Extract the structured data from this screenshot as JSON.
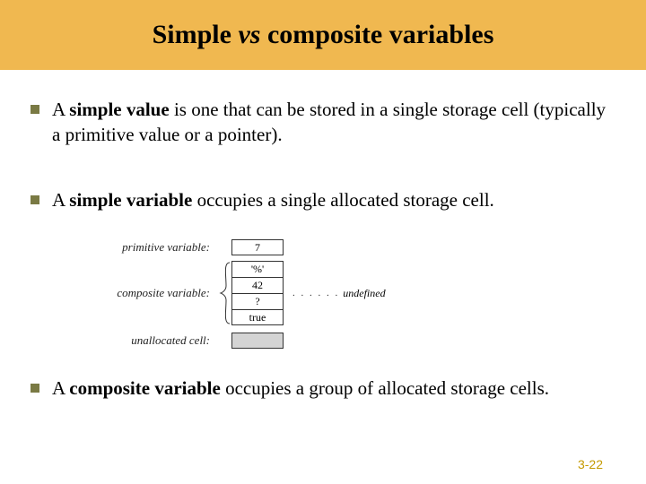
{
  "header": {
    "title_pre": "Simple ",
    "title_vs": "vs",
    "title_post": " composite variables"
  },
  "bullets": {
    "b1_pre": "A ",
    "b1_bold": "simple value",
    "b1_post": " is one that can be stored in a single storage cell (typically a primitive value or a pointer).",
    "b2_pre": "A ",
    "b2_bold": "simple variable",
    "b2_post": " occupies a single allocated storage cell.",
    "b3_pre": "A ",
    "b3_bold": "composite variable",
    "b3_post": " occupies a group of allocated storage cells."
  },
  "diagram": {
    "primitive_label": "primitive variable:",
    "primitive_value": "7",
    "composite_label": "composite variable:",
    "composite_cells": {
      "c0": "'%'",
      "c1": "42",
      "c2": "?",
      "c3": "true"
    },
    "undefined_label": "undefined",
    "unallocated_label": "unallocated cell:"
  },
  "slide_number": "3-22"
}
